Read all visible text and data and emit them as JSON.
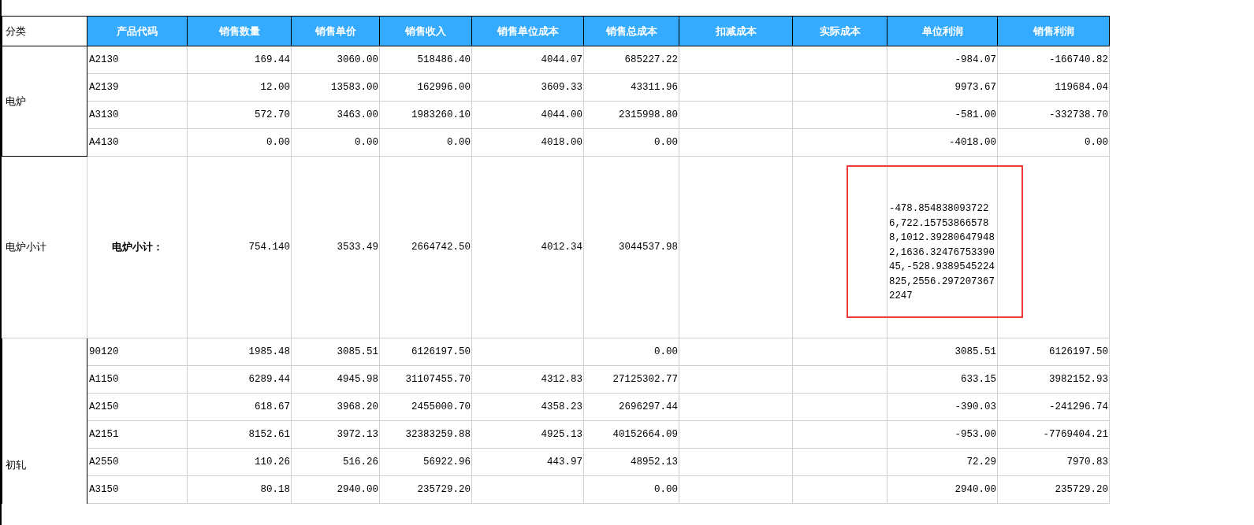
{
  "table": {
    "category_header": "分类",
    "columns": [
      "产品代码",
      "销售数量",
      "销售单价",
      "销售收入",
      "销售单位成本",
      "销售总成本",
      "扣减成本",
      "实际成本",
      "单位利润",
      "销售利润"
    ],
    "sections": [
      {
        "kind": "group",
        "category": "电炉",
        "rows": [
          [
            "A2130",
            "169.44",
            "3060.00",
            "518486.40",
            "4044.07",
            "685227.22",
            null,
            null,
            "-984.07",
            "-166740.82"
          ],
          [
            "A2139",
            "12.00",
            "13583.00",
            "162996.00",
            "3609.33",
            "43311.96",
            null,
            null,
            "9973.67",
            "119684.04"
          ],
          [
            "A3130",
            "572.70",
            "3463.00",
            "1983260.10",
            "4044.00",
            "2315998.80",
            null,
            null,
            "-581.00",
            "-332738.70"
          ],
          [
            "A4130",
            "0.00",
            "0.00",
            "0.00",
            "4018.00",
            "0.00",
            null,
            null,
            "-4018.00",
            "0.00"
          ]
        ]
      },
      {
        "kind": "subtotal",
        "category": "电炉小计",
        "label": "电炉小计：",
        "cells": [
          "754.140",
          "3533.49",
          "2664742.50",
          "4012.34",
          "3044537.98",
          null,
          null,
          {
            "text": "-478.8548380937226,722.157538665788,1012.392806479482,1636.3247675339045,-528.9389545224825,2556.2972073672247",
            "highlighted": true
          },
          null
        ]
      },
      {
        "kind": "group",
        "category": "初轧",
        "rows": [
          [
            "90120",
            "1985.48",
            "3085.51",
            "6126197.50",
            null,
            "0.00",
            null,
            null,
            "3085.51",
            "6126197.50"
          ],
          [
            "A1150",
            "6289.44",
            "4945.98",
            "31107455.70",
            "4312.83",
            "27125302.77",
            null,
            null,
            "633.15",
            "3982152.93"
          ],
          [
            "A2150",
            "618.67",
            "3968.20",
            "2455000.70",
            "4358.23",
            "2696297.44",
            null,
            null,
            "-390.03",
            "-241296.74"
          ],
          [
            "A2151",
            "8152.61",
            "3972.13",
            "32383259.88",
            "4925.13",
            "40152664.09",
            null,
            null,
            "-953.00",
            "-7769404.21"
          ],
          [
            "A2550",
            "110.26",
            "516.26",
            "56922.96",
            "443.97",
            "48952.13",
            null,
            null,
            "72.29",
            "7970.83"
          ],
          [
            "A3150",
            "80.18",
            "2940.00",
            "235729.20",
            null,
            "0.00",
            null,
            null,
            "2940.00",
            "235729.20"
          ]
        ]
      }
    ]
  }
}
